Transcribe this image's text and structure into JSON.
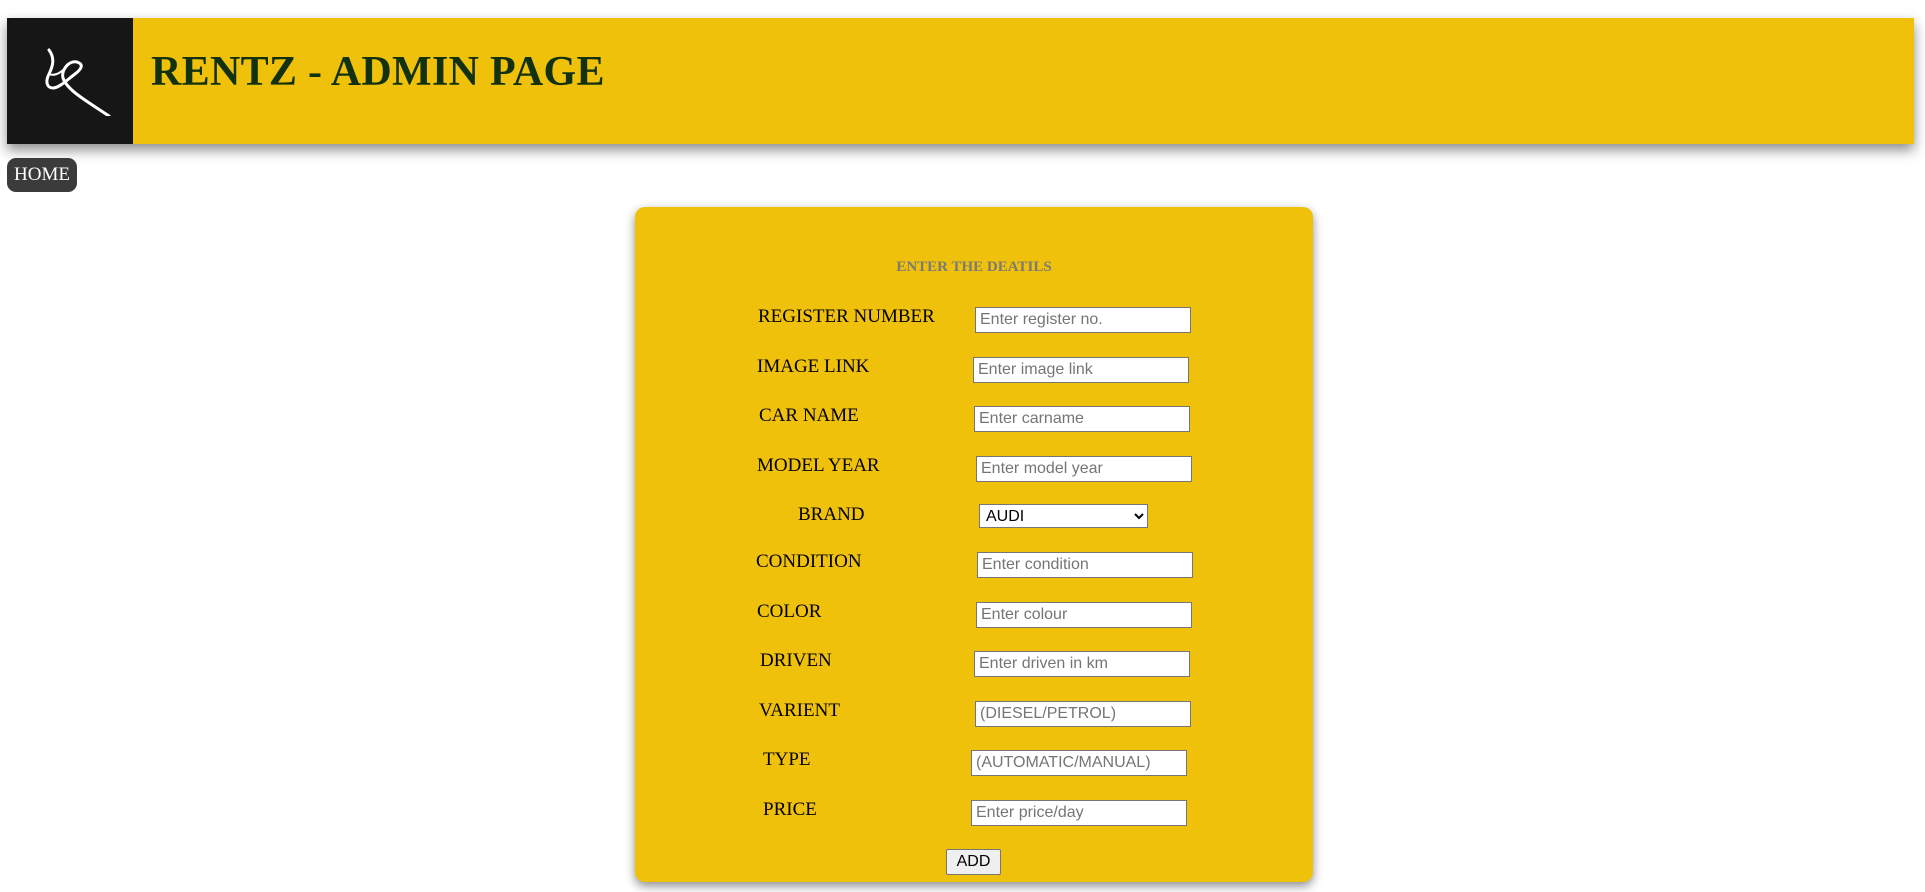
{
  "header": {
    "title": "RENTZ - ADMIN PAGE",
    "logo_icon": "rentz-logo-icon",
    "background_color": "#efc10b",
    "logo_background_color": "#161616",
    "title_color": "#12320f"
  },
  "nav": {
    "home_label": "HOME"
  },
  "form": {
    "heading": "ENTER THE DEATILS",
    "background_color": "#efc10b",
    "fields": {
      "register_number": {
        "label": "REGISTER NUMBER",
        "placeholder": "Enter register no.",
        "value": ""
      },
      "image_link": {
        "label": "IMAGE LINK",
        "placeholder": "Enter image link",
        "value": ""
      },
      "car_name": {
        "label": "CAR NAME",
        "placeholder": "Enter carname",
        "value": ""
      },
      "model_year": {
        "label": "MODEL YEAR",
        "placeholder": "Enter model year",
        "value": ""
      },
      "brand": {
        "label": "BRAND",
        "selected": "AUDI"
      },
      "condition": {
        "label": "CONDITION",
        "placeholder": "Enter condition",
        "value": ""
      },
      "color": {
        "label": "COLOR",
        "placeholder": "Enter colour",
        "value": ""
      },
      "driven": {
        "label": "DRIVEN",
        "placeholder": "Enter driven in km",
        "value": ""
      },
      "varient": {
        "label": "VARIENT",
        "placeholder": "(DIESEL/PETROL)",
        "value": ""
      },
      "type": {
        "label": "TYPE",
        "placeholder": "(AUTOMATIC/MANUAL)",
        "value": ""
      },
      "price": {
        "label": "PRICE",
        "placeholder": "Enter price/day",
        "value": ""
      }
    },
    "submit_label": "ADD"
  }
}
